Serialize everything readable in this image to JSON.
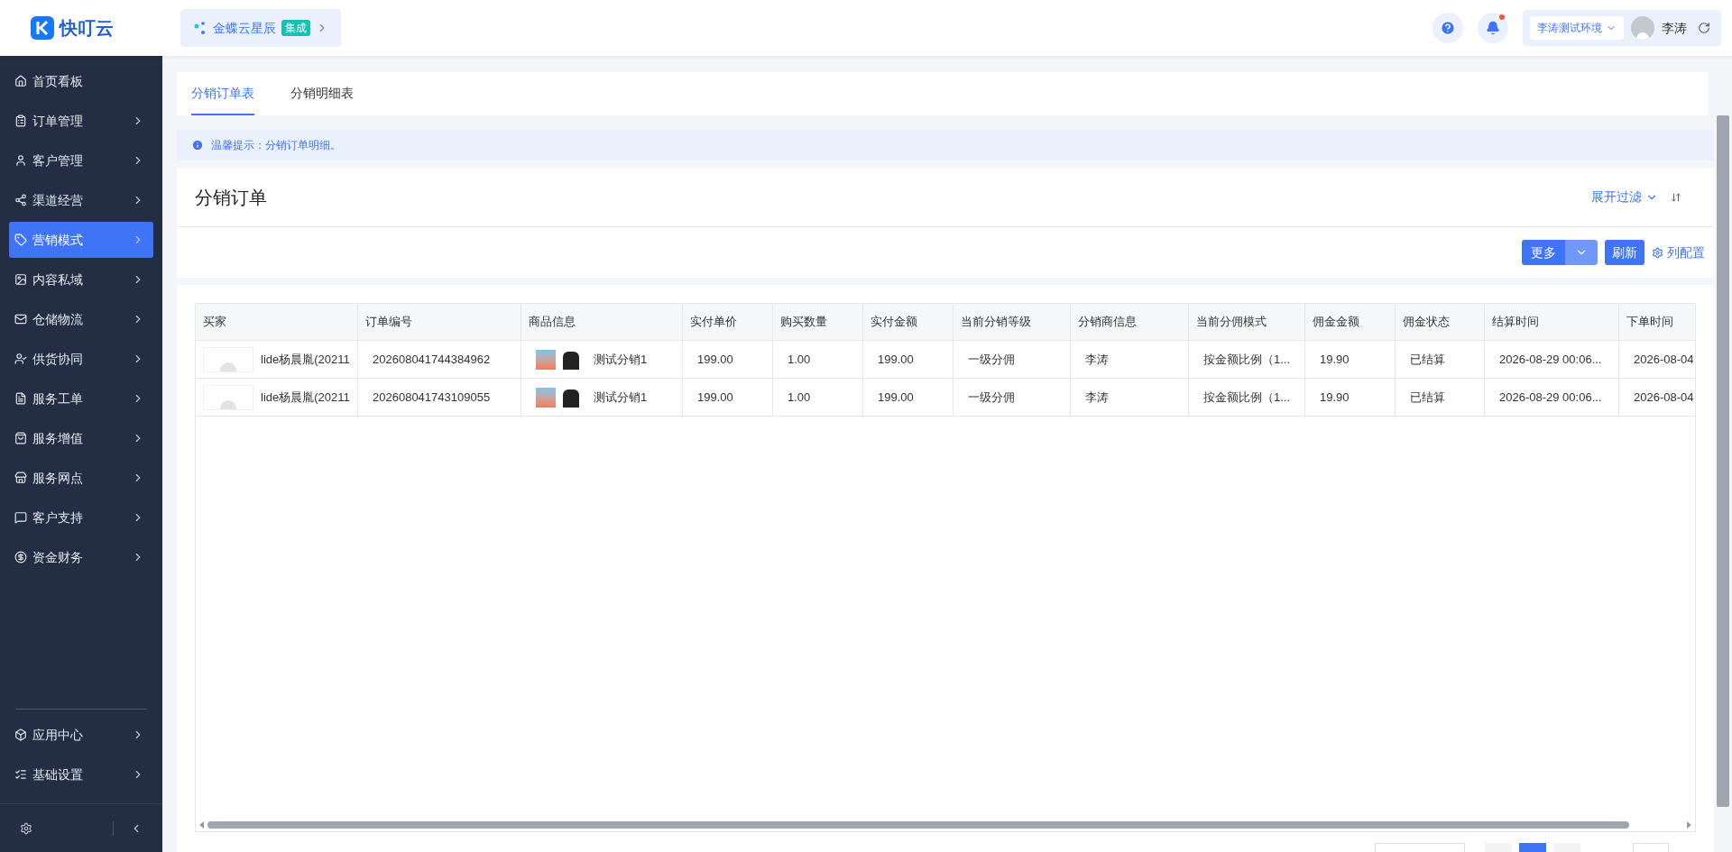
{
  "brand": {
    "name": "快叮云"
  },
  "workspace": {
    "name": "金蝶云星辰",
    "badge": "集成"
  },
  "header": {
    "environment": "李涛测试环境",
    "user": "李涛",
    "notification_dot": true
  },
  "sidebar": {
    "items": [
      {
        "label": "首页看板",
        "selected": false,
        "expandable": false
      },
      {
        "label": "订单管理",
        "selected": false,
        "expandable": true
      },
      {
        "label": "客户管理",
        "selected": false,
        "expandable": true
      },
      {
        "label": "渠道经营",
        "selected": false,
        "expandable": true
      },
      {
        "label": "营销模式",
        "selected": true,
        "expandable": true
      },
      {
        "label": "内容私域",
        "selected": false,
        "expandable": true
      },
      {
        "label": "仓储物流",
        "selected": false,
        "expandable": true
      },
      {
        "label": "供货协同",
        "selected": false,
        "expandable": true
      },
      {
        "label": "服务工单",
        "selected": false,
        "expandable": true
      },
      {
        "label": "服务增值",
        "selected": false,
        "expandable": true
      },
      {
        "label": "服务网点",
        "selected": false,
        "expandable": true
      },
      {
        "label": "客户支持",
        "selected": false,
        "expandable": true
      },
      {
        "label": "资金财务",
        "selected": false,
        "expandable": true
      }
    ],
    "bottom_items": [
      {
        "label": "应用中心",
        "selected": false,
        "expandable": true
      },
      {
        "label": "基础设置",
        "selected": false,
        "expandable": true
      }
    ]
  },
  "tabs": [
    {
      "label": "分销订单表",
      "selected": true
    },
    {
      "label": "分销明细表",
      "selected": false
    }
  ],
  "notice": "温馨提示：分销订单明细。",
  "card": {
    "title": "分销订单",
    "filter_toggle": "展开过滤"
  },
  "toolbar": {
    "more": "更多",
    "refresh": "刷新",
    "columns": "列配置"
  },
  "table": {
    "columns": [
      "买家",
      "订单编号",
      "商品信息",
      "实付单价",
      "购买数量",
      "实付金额",
      "当前分销等级",
      "分销商信息",
      "当前分佣模式",
      "佣金金额",
      "佣金状态",
      "结算时间",
      "下单时间"
    ],
    "rows": [
      {
        "cells": [
          "lide杨晨胤(20211",
          "202608041744384962",
          "测试分销1",
          "199.00",
          "1.00",
          "199.00",
          "一级分佣",
          "李涛",
          "按金额比例（1...",
          "19.90",
          "已结算",
          "2026-08-29 00:06...",
          "2026-08-04"
        ]
      },
      {
        "cells": [
          "lide杨晨胤(20211",
          "202608041743109055",
          "测试分销1",
          "199.00",
          "1.00",
          "199.00",
          "一级分佣",
          "李涛",
          "按金额比例（1...",
          "19.90",
          "已结算",
          "2026-08-29 00:06...",
          "2026-08-04"
        ]
      }
    ]
  }
}
